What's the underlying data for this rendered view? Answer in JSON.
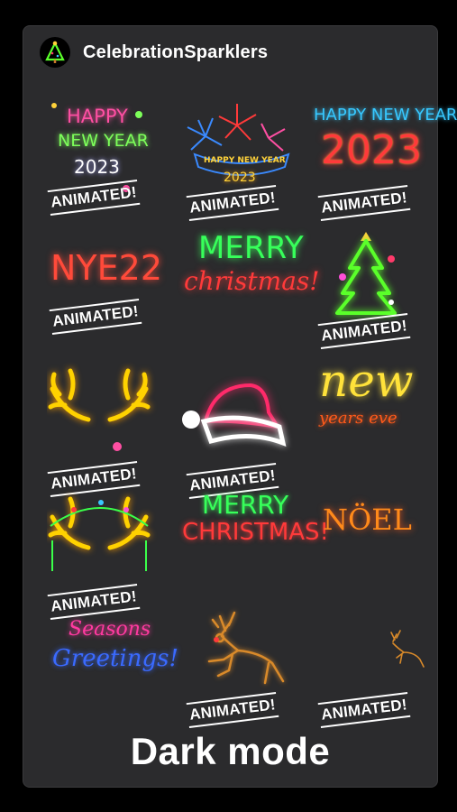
{
  "account": {
    "name": "CelebrationSparklers",
    "avatar_icon": "christmas-tree-icon"
  },
  "tag_label": "ANIMATED!",
  "stickers": [
    {
      "lines": [
        "HAPPY",
        "NEW YEAR",
        "2023"
      ],
      "colors": [
        "#ff4fa3",
        "#7dff5a",
        "#ffffff"
      ]
    },
    {
      "lines": [
        "HAPPY NEW YEAR",
        "2023"
      ],
      "colors": [
        "#ffd23a",
        "#ffd23a"
      ]
    },
    {
      "lines": [
        "HAPPY NEW YEAR",
        "2023"
      ],
      "colors": [
        "#37c8ff",
        "#ff3a3a"
      ]
    },
    {
      "lines": [
        "NYE22"
      ],
      "colors": [
        "#ff4a3a"
      ]
    },
    {
      "lines": [
        "MERRY",
        "christmas!"
      ],
      "colors": [
        "#37ff5a",
        "#ff3a3a"
      ]
    },
    {
      "lines": [],
      "colors": [
        "#5aff2a",
        "#ffd23a"
      ]
    },
    {
      "lines": [],
      "colors": [
        "#ffd200"
      ]
    },
    {
      "lines": [],
      "colors": [
        "#ff2a6a",
        "#ffffff"
      ]
    },
    {
      "lines": [
        "new",
        "years eve"
      ],
      "colors": [
        "#ffe23a",
        "#ff5a1a"
      ]
    },
    {
      "lines": [],
      "colors": [
        "#ffd200",
        "#3aff4a"
      ]
    },
    {
      "lines": [
        "MERRY",
        "CHRISTMAS!"
      ],
      "colors": [
        "#37ff5a",
        "#ff3a3a"
      ]
    },
    {
      "lines": [
        "NÖEL"
      ],
      "colors": [
        "#ff8a1a"
      ]
    },
    {
      "lines": [
        "Seasons",
        "Greetings!"
      ],
      "colors": [
        "#ff3aa0",
        "#3a6aff"
      ]
    },
    {
      "lines": [],
      "colors": [
        "#d98a2a"
      ]
    },
    {
      "lines": [],
      "colors": [
        "#d98a2a"
      ]
    }
  ],
  "footer": {
    "label": "Dark mode"
  }
}
